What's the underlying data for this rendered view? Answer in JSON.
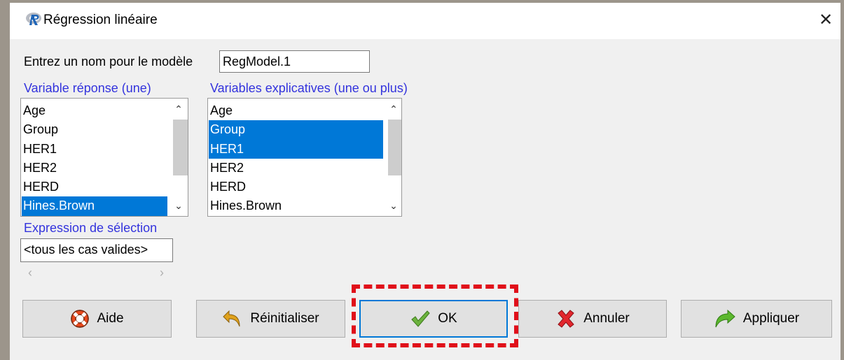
{
  "window": {
    "title": "Régression linéaire"
  },
  "model_name": {
    "label": "Entrez un nom pour le modèle",
    "value": "RegModel.1"
  },
  "response": {
    "label": "Variable réponse (une)",
    "items": [
      {
        "label": "Age",
        "selected": false
      },
      {
        "label": "Group",
        "selected": false
      },
      {
        "label": "HER1",
        "selected": false
      },
      {
        "label": "HER2",
        "selected": false
      },
      {
        "label": "HERD",
        "selected": false
      },
      {
        "label": "Hines.Brown",
        "selected": true
      }
    ]
  },
  "explanatory": {
    "label": "Variables explicatives (une ou plus)",
    "items": [
      {
        "label": "Age",
        "selected": false
      },
      {
        "label": "Group",
        "selected": true
      },
      {
        "label": "HER1",
        "selected": true
      },
      {
        "label": "HER2",
        "selected": false
      },
      {
        "label": "HERD",
        "selected": false
      },
      {
        "label": "Hines.Brown",
        "selected": false
      }
    ]
  },
  "subset": {
    "label": "Expression de sélection",
    "value": "<tous les cas valides>"
  },
  "buttons": {
    "help": "Aide",
    "reset": "Réinitialiser",
    "ok": "OK",
    "cancel": "Annuler",
    "apply": "Appliquer"
  },
  "colors": {
    "selection": "#0078d7",
    "highlight": "#e0101a",
    "label_blue": "#3333dd"
  }
}
